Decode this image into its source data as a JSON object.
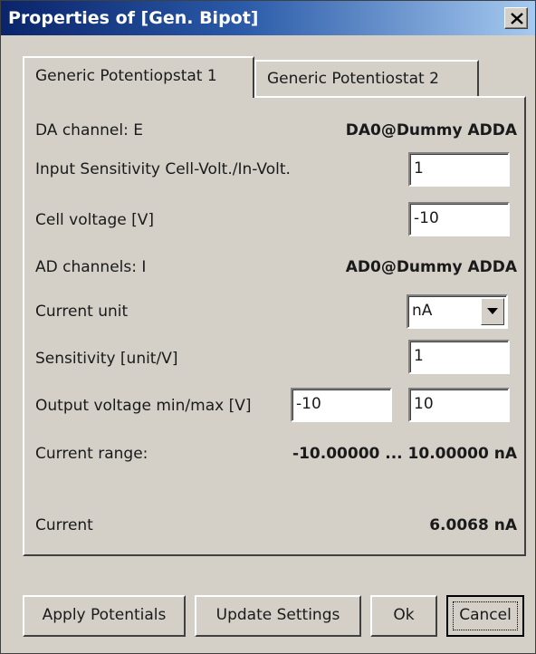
{
  "window": {
    "title": "Properties of [Gen. Bipot]"
  },
  "tabs": [
    {
      "label": "Generic Potentiopstat 1",
      "active": true
    },
    {
      "label": "Generic Potentiostat 2",
      "active": false
    }
  ],
  "panel": {
    "da_channel": {
      "label": "DA channel: E",
      "value": "DA0@Dummy ADDA"
    },
    "input_sensitivity": {
      "label": "Input Sensitivity Cell-Volt./In-Volt.",
      "value": "1"
    },
    "cell_voltage": {
      "label": "Cell voltage [V]",
      "value": "-10"
    },
    "ad_channels": {
      "label": "AD channels: I",
      "value": "AD0@Dummy ADDA"
    },
    "current_unit": {
      "label": "Current unit",
      "value": "nA"
    },
    "sensitivity": {
      "label": "Sensitivity [unit/V]",
      "value": "1"
    },
    "output_voltage": {
      "label": "Output voltage min/max [V]",
      "min": "-10",
      "max": "10"
    },
    "current_range": {
      "label": "Current range:",
      "value": "-10.00000 ... 10.00000 nA"
    },
    "current": {
      "label": "Current",
      "value": "6.0068 nA"
    }
  },
  "buttons": {
    "apply": "Apply Potentials",
    "update": "Update Settings",
    "ok": "Ok",
    "cancel": "Cancel"
  },
  "colors": {
    "title_gradient_start": "#0a246a",
    "title_gradient_end": "#a6caf0",
    "face": "#d4d0c8"
  },
  "icons": {
    "close": "close-icon",
    "dropdown": "chevron-down-icon"
  }
}
